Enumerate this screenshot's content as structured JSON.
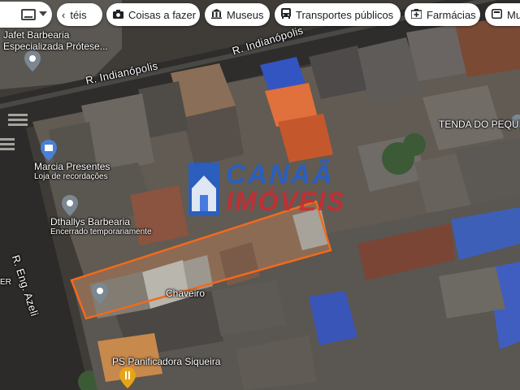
{
  "toolbar": {
    "keyboard_icon": "keyboard-icon",
    "partial_chip": "téis",
    "chips": [
      {
        "label": "Coisas a fazer",
        "icon": "camera-icon"
      },
      {
        "label": "Museus",
        "icon": "museum-icon"
      },
      {
        "label": "Transportes públicos",
        "icon": "bus-icon"
      },
      {
        "label": "Farmácias",
        "icon": "pharmacy-icon"
      },
      {
        "label": "Mu",
        "icon": "misc-icon"
      }
    ]
  },
  "streets": {
    "indianopolis_1": "R. Indianópolis",
    "indianopolis_2": "R. Indianópolis",
    "eng_azeli": "R. Eng. Azeli"
  },
  "places": {
    "jafet": {
      "name": "Jafet Barbearia",
      "sub": "Especializada Prótese..."
    },
    "marcia": {
      "name": "Marcia Presentes",
      "sub": "Loja de recordações"
    },
    "dthallys": {
      "name": "Dthallys Barbearia",
      "sub": "Encerrado temporariamente"
    },
    "tenda": "TENDA DO PEQUI",
    "chaveiro": "Chaveiro",
    "panificadora": "PS Panificadora Siqueira",
    "edge_left": "ER"
  },
  "watermark": {
    "line1": "CANAÃ",
    "line2": "IMÓVEIS"
  },
  "colors": {
    "lot_outline": "#f26a1b",
    "pin_gray": "#7b8791",
    "pin_blue": "#4a7fd6",
    "pin_orange": "#e6a417",
    "watermark_blue": "#1e5fd8",
    "watermark_red": "#d6262e"
  }
}
